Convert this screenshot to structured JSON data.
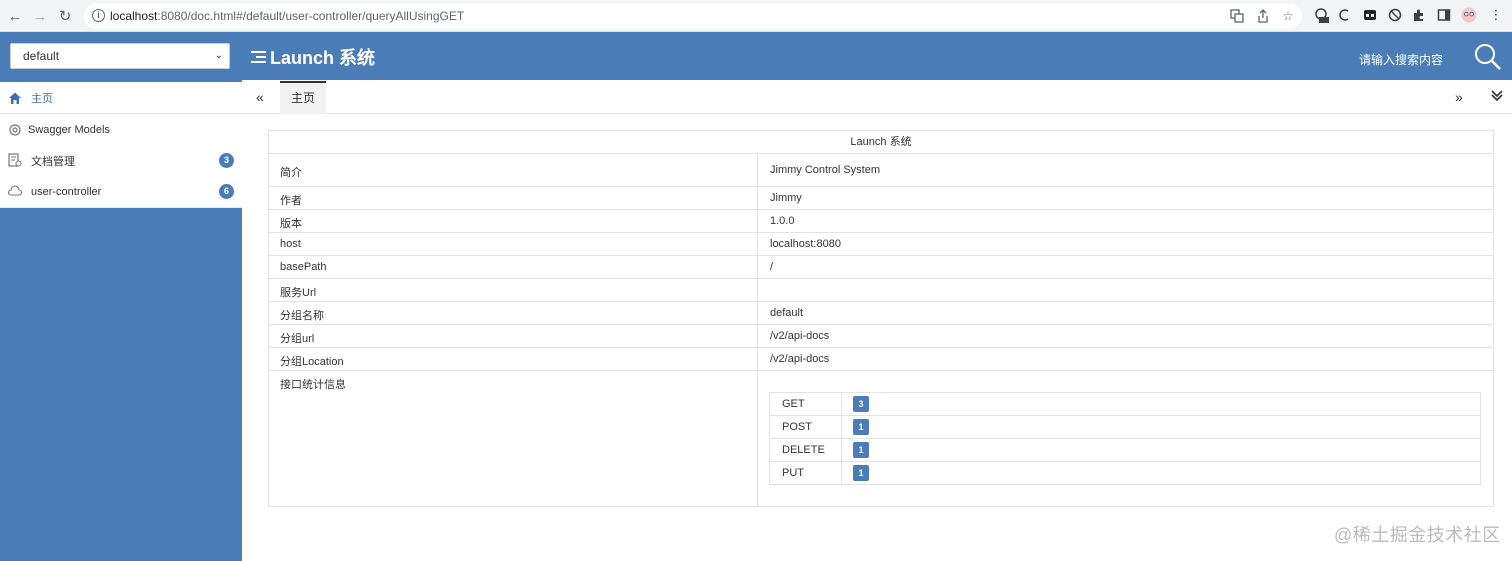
{
  "browser": {
    "url_host": "localhost",
    "url_rest": ":8080/doc.html#/default/user-controller/queryAllUsingGET"
  },
  "header": {
    "group_selected": "default",
    "title": "Launch 系统",
    "search_placeholder": "请输入搜索内容"
  },
  "sidebar": {
    "items": [
      {
        "label": "主页"
      },
      {
        "label": "Swagger Models"
      },
      {
        "label": "文档管理",
        "badge": "3"
      },
      {
        "label": "user-controller",
        "badge": "6"
      }
    ]
  },
  "tabs": [
    {
      "label": "主页"
    }
  ],
  "info": {
    "caption": "Launch 系统",
    "rows": [
      {
        "key": "简介",
        "value": "Jimmy Control System"
      },
      {
        "key": "作者",
        "value": "Jimmy"
      },
      {
        "key": "版本",
        "value": "1.0.0"
      },
      {
        "key": "host",
        "value": "localhost:8080"
      },
      {
        "key": "basePath",
        "value": "/"
      },
      {
        "key": "服务Url",
        "value": ""
      },
      {
        "key": "分组名称",
        "value": "default"
      },
      {
        "key": "分组url",
        "value": "/v2/api-docs"
      },
      {
        "key": "分组Location",
        "value": "/v2/api-docs"
      },
      {
        "key": "接口统计信息",
        "value": ""
      }
    ],
    "stats": [
      {
        "method": "GET",
        "count": "3"
      },
      {
        "method": "POST",
        "count": "1"
      },
      {
        "method": "DELETE",
        "count": "1"
      },
      {
        "method": "PUT",
        "count": "1"
      }
    ]
  },
  "watermark": "@稀土掘金技术社区",
  "colors": {
    "brand": "#4a7db8"
  }
}
